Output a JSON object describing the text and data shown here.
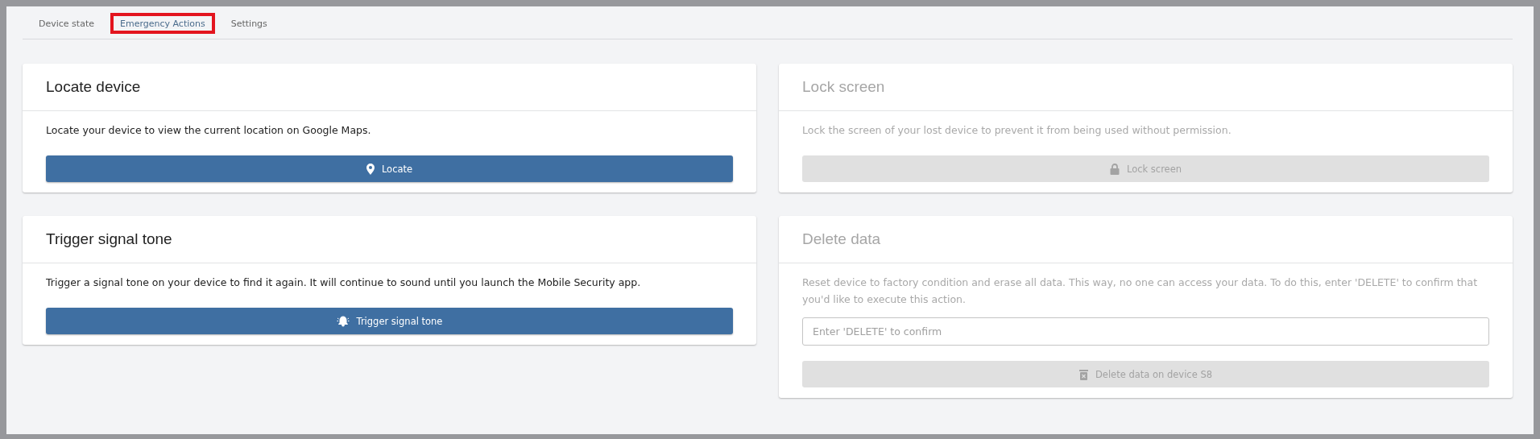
{
  "tabs": [
    {
      "label": "Device state",
      "selected": false
    },
    {
      "label": "Emergency Actions",
      "selected": true
    },
    {
      "label": "Settings",
      "selected": false
    }
  ],
  "columns": [
    {
      "cards": [
        {
          "title": "Locate device",
          "description": "Locate your device to view the current location on Google Maps.",
          "disabled": false,
          "button": "Locate"
        },
        {
          "title": "Trigger signal tone",
          "description": "Trigger a signal tone on your device to find it again. It will continue to sound until you launch the Mobile Security app.",
          "disabled": false,
          "button": "Trigger signal tone"
        }
      ]
    },
    {
      "cards": [
        {
          "title": "Lock screen",
          "description": "Lock the screen of your lost device to prevent it from being used without permission.",
          "disabled": true,
          "button": "Lock screen"
        },
        {
          "title": "Delete data",
          "description": "Reset device to factory condition and erase all data. This way, no one can access your data. To do this, enter 'DELETE' to confirm that you'd like to execute this action.",
          "disabled": true,
          "field": {
            "placeholder": "Enter 'DELETE' to confirm"
          },
          "button": "Delete data on device S8"
        }
      ]
    }
  ]
}
